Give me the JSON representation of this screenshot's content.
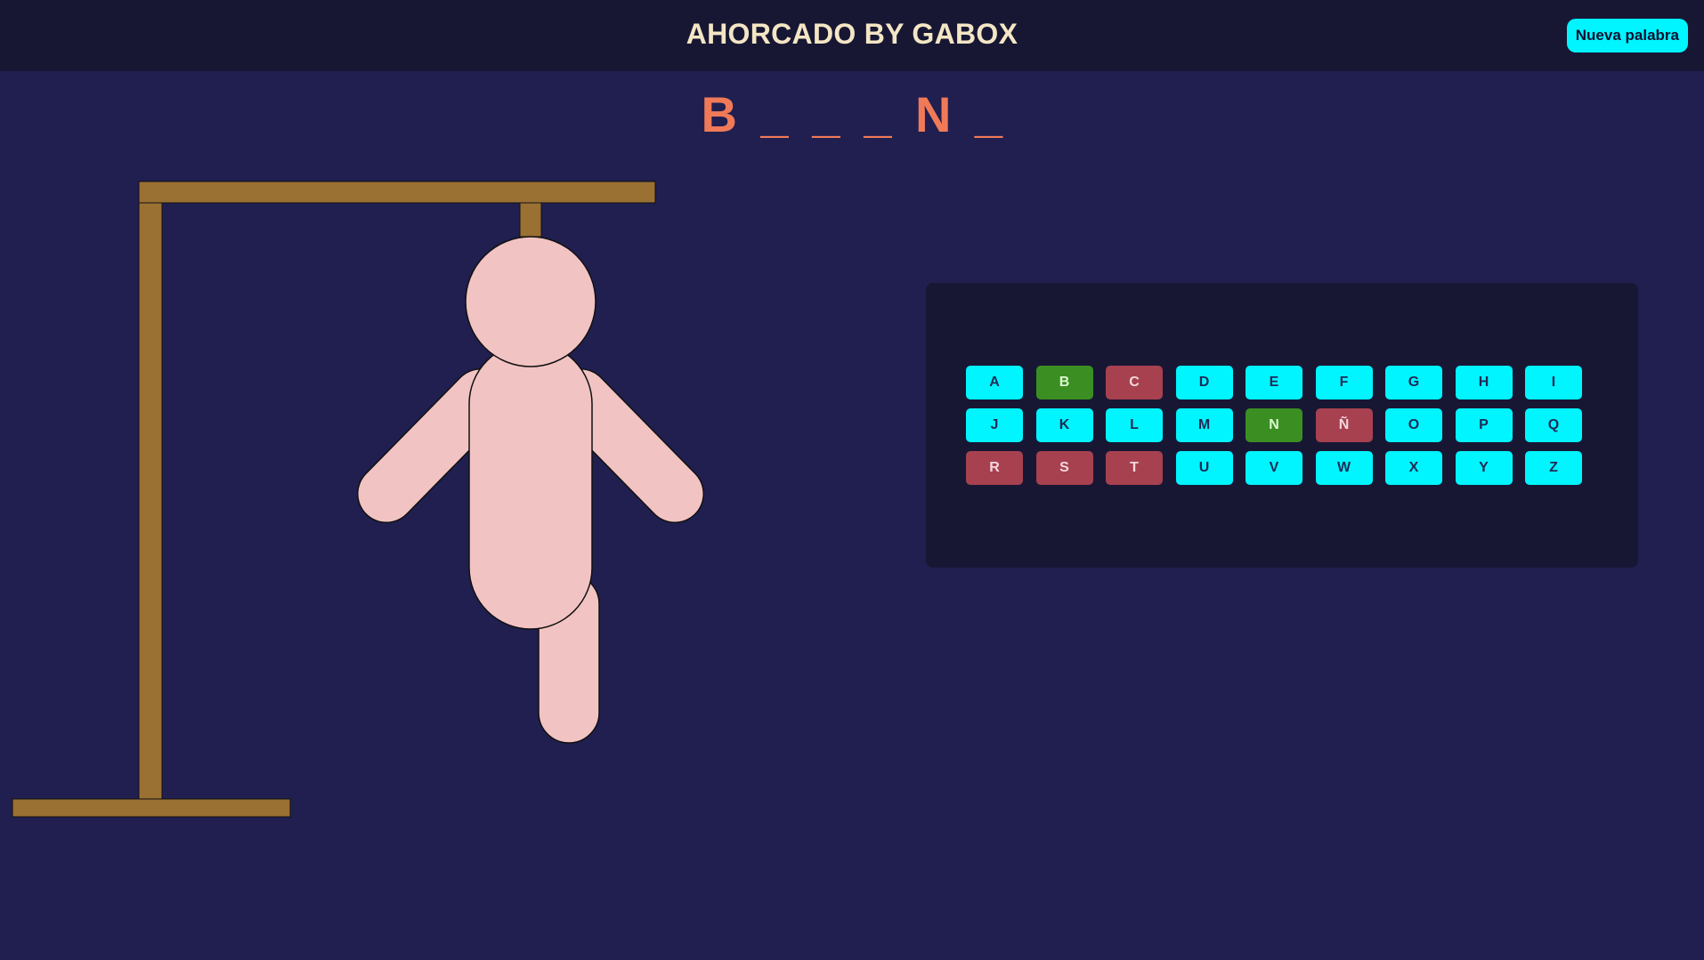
{
  "header": {
    "title": "AHORCADO BY GABOX",
    "new_word_label": "Nueva palabra"
  },
  "word": {
    "slots": [
      "B",
      "_",
      "_",
      "_",
      "N",
      "_"
    ]
  },
  "hangman": {
    "parts_shown": [
      "head",
      "body",
      "left-arm",
      "right-arm",
      "right-leg"
    ],
    "colors": {
      "wood": "#9a7033",
      "figure": "#f2c3c3"
    }
  },
  "keyboard": {
    "keys": [
      {
        "letter": "A",
        "state": "available"
      },
      {
        "letter": "B",
        "state": "correct"
      },
      {
        "letter": "C",
        "state": "wrong"
      },
      {
        "letter": "D",
        "state": "available"
      },
      {
        "letter": "E",
        "state": "available"
      },
      {
        "letter": "F",
        "state": "available"
      },
      {
        "letter": "G",
        "state": "available"
      },
      {
        "letter": "H",
        "state": "available"
      },
      {
        "letter": "I",
        "state": "available"
      },
      {
        "letter": "J",
        "state": "available"
      },
      {
        "letter": "K",
        "state": "available"
      },
      {
        "letter": "L",
        "state": "available"
      },
      {
        "letter": "M",
        "state": "available"
      },
      {
        "letter": "N",
        "state": "correct"
      },
      {
        "letter": "Ñ",
        "state": "wrong"
      },
      {
        "letter": "O",
        "state": "available"
      },
      {
        "letter": "P",
        "state": "available"
      },
      {
        "letter": "Q",
        "state": "available"
      },
      {
        "letter": "R",
        "state": "wrong"
      },
      {
        "letter": "S",
        "state": "wrong"
      },
      {
        "letter": "T",
        "state": "wrong"
      },
      {
        "letter": "U",
        "state": "available"
      },
      {
        "letter": "V",
        "state": "available"
      },
      {
        "letter": "W",
        "state": "available"
      },
      {
        "letter": "X",
        "state": "available"
      },
      {
        "letter": "Y",
        "state": "available"
      },
      {
        "letter": "Z",
        "state": "available"
      }
    ],
    "colors": {
      "available": "#00f5ff",
      "correct": "#3b8f22",
      "wrong": "#a74150"
    }
  }
}
